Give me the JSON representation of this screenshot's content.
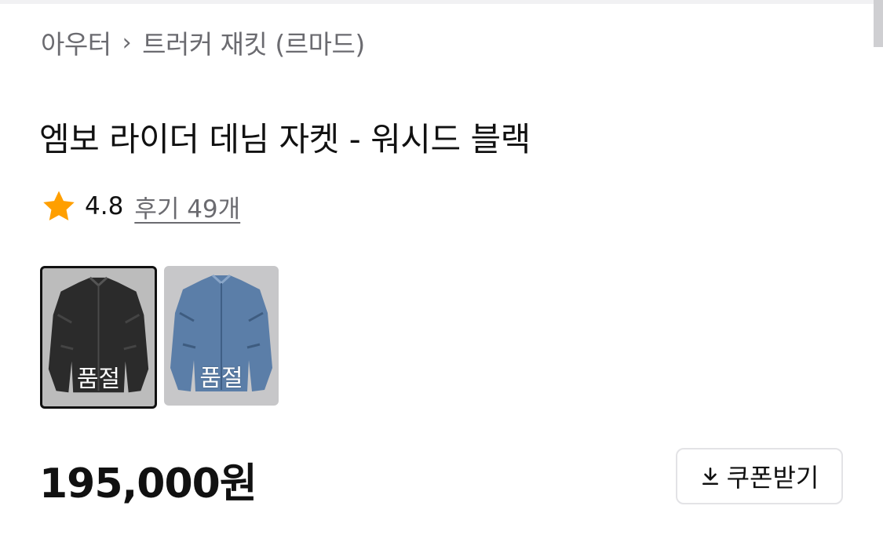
{
  "breadcrumb": {
    "category": "아우터",
    "separator": "›",
    "subcategory": "트러커 재킷 (르마드)"
  },
  "product": {
    "title": "엠보 라이더 데님 자켓 - 워시드 블랙",
    "rating": "4.8",
    "review_link": "후기 49개",
    "price": "195,000원"
  },
  "variants": [
    {
      "label": "품절",
      "color": "black",
      "selected": true
    },
    {
      "label": "품절",
      "color": "blue",
      "selected": false
    }
  ],
  "coupon": {
    "label": "쿠폰받기",
    "icon": "download-icon"
  },
  "colors": {
    "star": "#FF9F00",
    "text_primary": "#111111",
    "text_secondary": "#6B6B70"
  }
}
